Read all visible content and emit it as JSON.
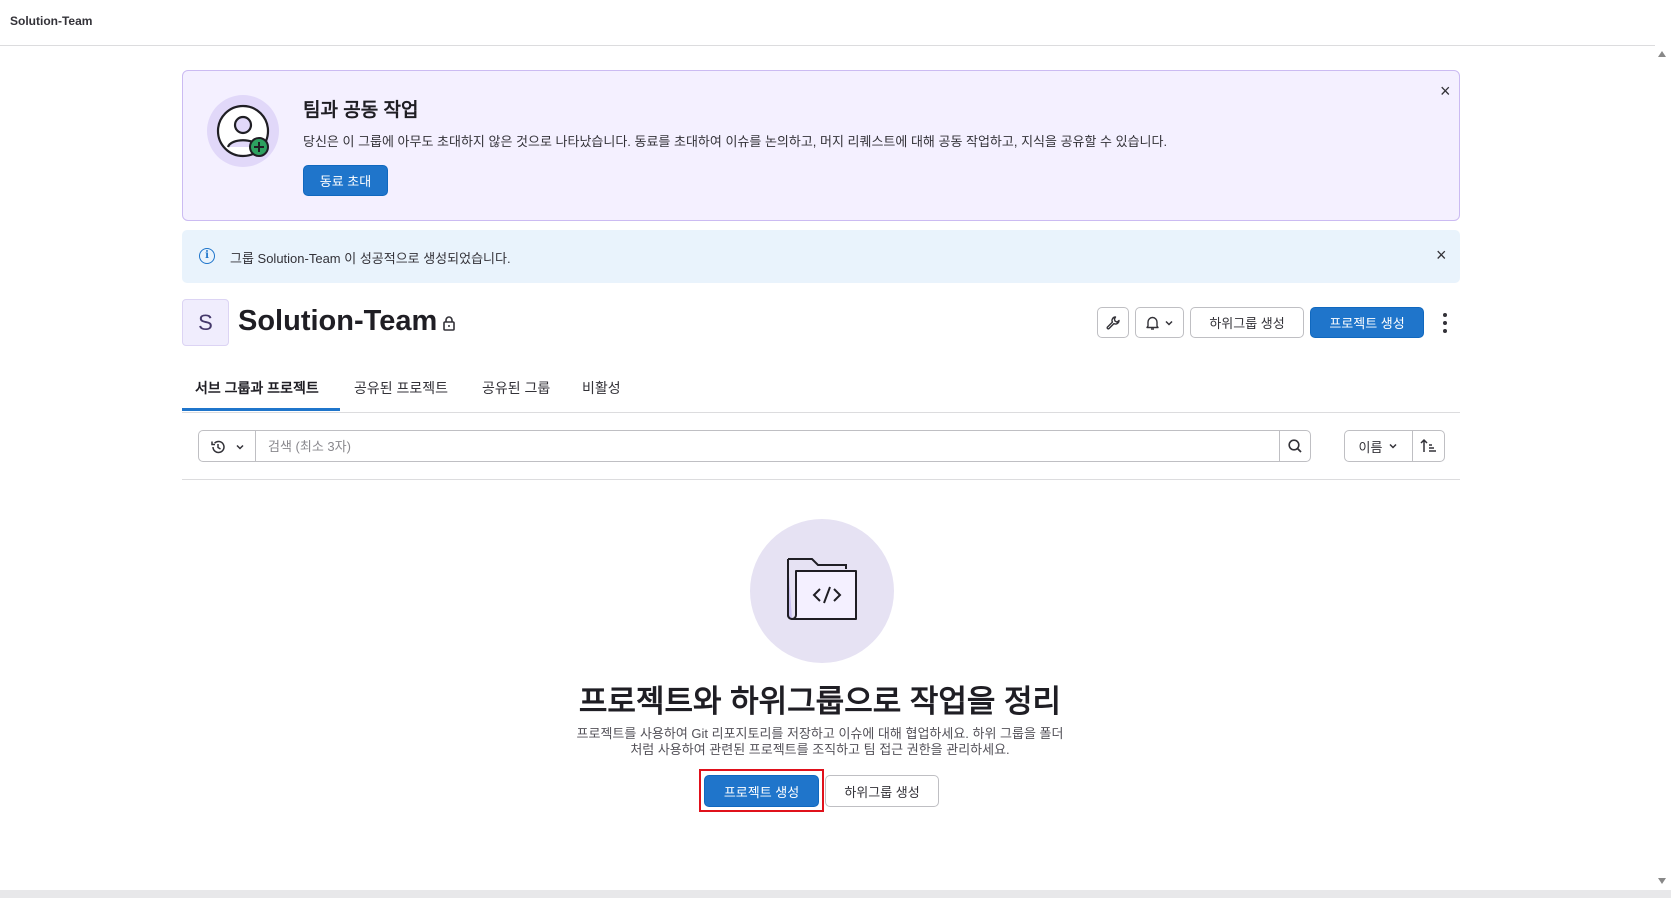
{
  "topbar": {
    "title": "Solution-Team"
  },
  "invite_banner": {
    "title": "팀과 공동 작업",
    "description": "당신은 이 그룹에 아무도 초대하지 않은 것으로 나타났습니다. 동료를 초대하여 이슈를 논의하고, 머지 리퀘스트에 대해 공동 작업하고, 지식을 공유할 수 있습니다.",
    "button_label": "동료 초대",
    "close_label": "×"
  },
  "alert": {
    "message": "그룹 Solution-Team 이 성공적으로 생성되었습니다.",
    "close_label": "×",
    "info_glyph": "i"
  },
  "group": {
    "avatar_letter": "S",
    "name": "Solution-Team",
    "create_subgroup_label": "하위그룹 생성",
    "create_project_label": "프로젝트 생성"
  },
  "tabs": [
    {
      "label": "서브 그룹과 프로젝트",
      "active": true
    },
    {
      "label": "공유된 프로젝트",
      "active": false
    },
    {
      "label": "공유된 그룹",
      "active": false
    },
    {
      "label": "비활성",
      "active": false
    }
  ],
  "search": {
    "placeholder": "검색 (최소 3자)",
    "value": "",
    "sort_label": "이름"
  },
  "empty_state": {
    "title": "프로젝트와 하위그룹으로 작업을 정리",
    "description_line1": "프로젝트를 사용하여 Git 리포지토리를 저장하고 이슈에 대해 협업하세요. 하위 그룹을 폴더",
    "description_line2": "처럼 사용하여 관련된 프로젝트를 조직하고 팀 접근 권한을 관리하세요.",
    "create_project_label": "프로젝트 생성",
    "create_subgroup_label": "하위그룹 생성"
  },
  "colors": {
    "primary": "#1f75cb",
    "banner_bg": "#f4f0ff",
    "alert_bg": "#e9f3fc",
    "highlight": "#e0111b"
  },
  "icons": [
    "user-add-icon",
    "info-icon",
    "close-icon",
    "lock-icon",
    "wrench-icon",
    "bell-icon",
    "chevron-down-icon",
    "kebab-icon",
    "history-icon",
    "search-icon",
    "sort-ascending-icon",
    "folder-code-icon"
  ]
}
